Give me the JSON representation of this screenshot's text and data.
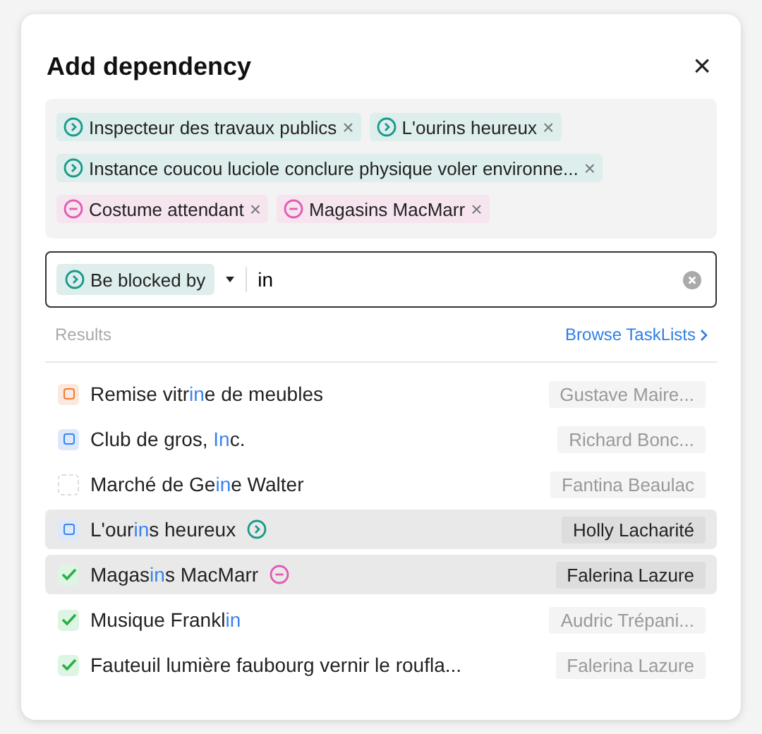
{
  "dialog": {
    "title": "Add dependency",
    "close": "×"
  },
  "tags": [
    {
      "kind": "blocked_by",
      "label": "Inspecteur des travaux publics",
      "remove": "×"
    },
    {
      "kind": "blocked_by",
      "label": "L'ourins heureux",
      "remove": "×"
    },
    {
      "kind": "blocked_by",
      "label": "Instance coucou luciole conclure physique voler environne...",
      "remove": "×"
    },
    {
      "kind": "blocking",
      "label": "Costume attendant",
      "remove": "×"
    },
    {
      "kind": "blocking",
      "label": "Magasins MacMarr",
      "remove": "×"
    }
  ],
  "search": {
    "relation": {
      "kind": "blocked_by",
      "label": "Be blocked by"
    },
    "value": "in"
  },
  "results_header": {
    "label": "Results",
    "link": "Browse TaskLists"
  },
  "results": [
    {
      "kind": "in_review",
      "parts": [
        {
          "text": "Remise vitr",
          "match": false
        },
        {
          "text": "in",
          "match": true
        },
        {
          "text": "e de meubles",
          "match": false
        }
      ],
      "assignee": "Gustave Maire...",
      "selected": false
    },
    {
      "kind": "in_progress",
      "parts": [
        {
          "text": "Club de gros, ",
          "match": false
        },
        {
          "text": "In",
          "match": true
        },
        {
          "text": "c.",
          "match": false
        }
      ],
      "assignee": "Richard Bonc...",
      "selected": false
    },
    {
      "kind": "todo",
      "parts": [
        {
          "text": "Marché de Ge",
          "match": false
        },
        {
          "text": "in",
          "match": true
        },
        {
          "text": "e Walter",
          "match": false
        }
      ],
      "assignee": "Fantina Beaulac",
      "selected": false
    },
    {
      "kind": "in_progress",
      "parts": [
        {
          "text": "L'our",
          "match": false
        },
        {
          "text": "in",
          "match": true
        },
        {
          "text": "s heureux",
          "match": false
        }
      ],
      "relation": {
        "kind": "blocked_by"
      },
      "assignee": "Holly Lacharité",
      "selected": true
    },
    {
      "kind": "done",
      "parts": [
        {
          "text": "Magas",
          "match": false
        },
        {
          "text": "in",
          "match": true
        },
        {
          "text": "s MacMarr",
          "match": false
        }
      ],
      "relation": {
        "kind": "blocking"
      },
      "assignee": "Falerina Lazure",
      "selected": true
    },
    {
      "kind": "done",
      "parts": [
        {
          "text": "Musique Frankl",
          "match": false
        },
        {
          "text": "in",
          "match": true
        }
      ],
      "assignee": "Audric Trépani...",
      "selected": false
    },
    {
      "kind": "done",
      "parts": [
        {
          "text": "Fauteuil lumière faubourg vernir le roufla...",
          "match": false
        }
      ],
      "assignee": "Falerina Lazure",
      "selected": false
    }
  ]
}
